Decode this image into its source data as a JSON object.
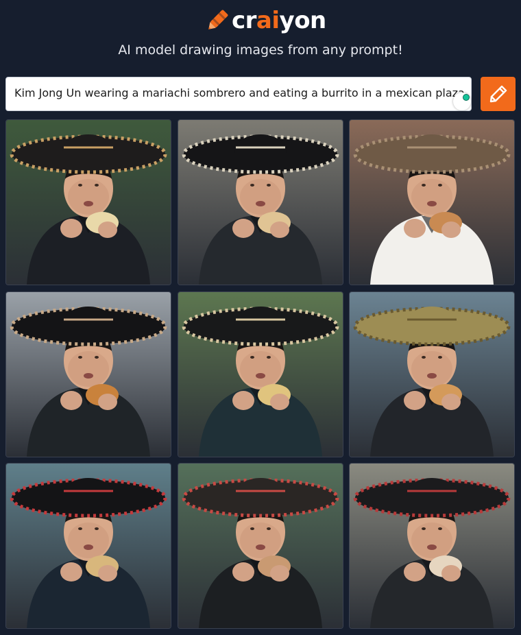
{
  "header": {
    "logo_part1": "cr",
    "logo_part2": "ai",
    "logo_part3": "yon",
    "tagline": "AI model drawing images from any prompt!"
  },
  "prompt": {
    "value": "Kim Jong Un wearing a mariachi sombrero and eating a burrito in a mexican plaza."
  },
  "colors": {
    "background": "#161e2e",
    "accent": "#f26a1b"
  },
  "grid": {
    "images": [
      {
        "name": "generated-image-1",
        "bg": "#3f5a3c",
        "hat": "#1e1c1c",
        "trim": "#c9a064",
        "suit": "#1c1f25",
        "food": "#e9d9a9"
      },
      {
        "name": "generated-image-2",
        "bg": "#7d7b73",
        "hat": "#151517",
        "trim": "#d9d1bd",
        "suit": "#25292e",
        "food": "#e0c494"
      },
      {
        "name": "generated-image-3",
        "bg": "#8a6a58",
        "hat": "#6f5a46",
        "trim": "#a99074",
        "suit": "#f2f0ec",
        "food": "#c98a52"
      },
      {
        "name": "generated-image-4",
        "bg": "#9aa1a8",
        "hat": "#141416",
        "trim": "#c8a987",
        "suit": "#1f2428",
        "food": "#c9823c"
      },
      {
        "name": "generated-image-5",
        "bg": "#5d7750",
        "hat": "#18191a",
        "trim": "#d8c6a0",
        "suit": "#1f3037",
        "food": "#e0c47e"
      },
      {
        "name": "generated-image-6",
        "bg": "#6b8392",
        "hat": "#9d8d54",
        "trim": "#6a5a30",
        "suit": "#22252a",
        "food": "#d49a5a"
      },
      {
        "name": "generated-image-7",
        "bg": "#5f7f8a",
        "hat": "#141416",
        "trim": "#c43a3c",
        "suit": "#1b2632",
        "food": "#d8b77c"
      },
      {
        "name": "generated-image-8",
        "bg": "#55705a",
        "hat": "#2a2624",
        "trim": "#c84a44",
        "suit": "#1c1f22",
        "food": "#c99a72"
      },
      {
        "name": "generated-image-9",
        "bg": "#8a8a80",
        "hat": "#1b1b1d",
        "trim": "#b83a3a",
        "suit": "#24272b",
        "food": "#e6d6c0"
      }
    ]
  }
}
